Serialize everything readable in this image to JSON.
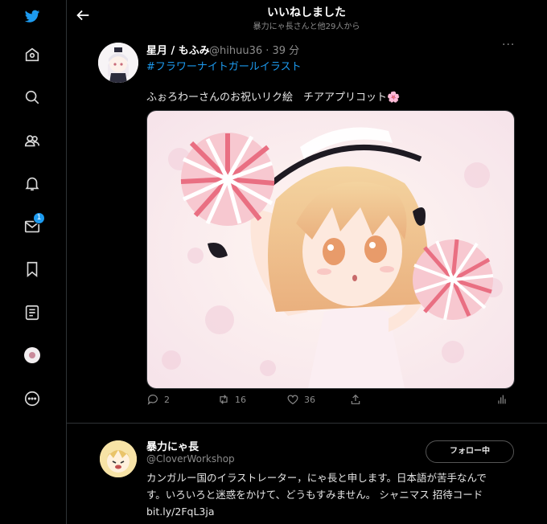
{
  "header": {
    "title": "いいねしました",
    "subtitle": "暴力にゃ長さんと他29人から"
  },
  "tweet": {
    "name": "星月 / もふみ",
    "handle": "@hihuu36 · 39 分",
    "hashtag": "#フラワーナイトガールイラスト",
    "text": "ふぉろわーさんのお祝いリク絵　チアアプリコット🌸",
    "actions": {
      "reply": "2",
      "retweet": "16",
      "like": "36"
    }
  },
  "profile": {
    "name": "暴力にゃ長",
    "handle": "@CloverWorkshop",
    "follow_label": "フォロー中",
    "bio_line1": "カンガルー国のイラストレーター，にゃ長と申します。日本語が苦手なんで",
    "bio_line2": "す。いろいろと迷惑をかけて、どうもすみません。 シャニマス 招待コード",
    "bio_line3": "bit.ly/2FqL3ja"
  },
  "nav": {
    "messages_badge": "1"
  },
  "colors": {
    "accent": "#1d9bf0",
    "background": "#000000",
    "divider": "#2f3336",
    "muted": "#8b8b8b"
  },
  "icons": [
    "twitter-logo-icon",
    "home-icon",
    "search-icon",
    "communities-icon",
    "bell-icon",
    "mail-icon",
    "bookmark-icon",
    "lists-icon",
    "profile-avatar",
    "more-icon"
  ]
}
